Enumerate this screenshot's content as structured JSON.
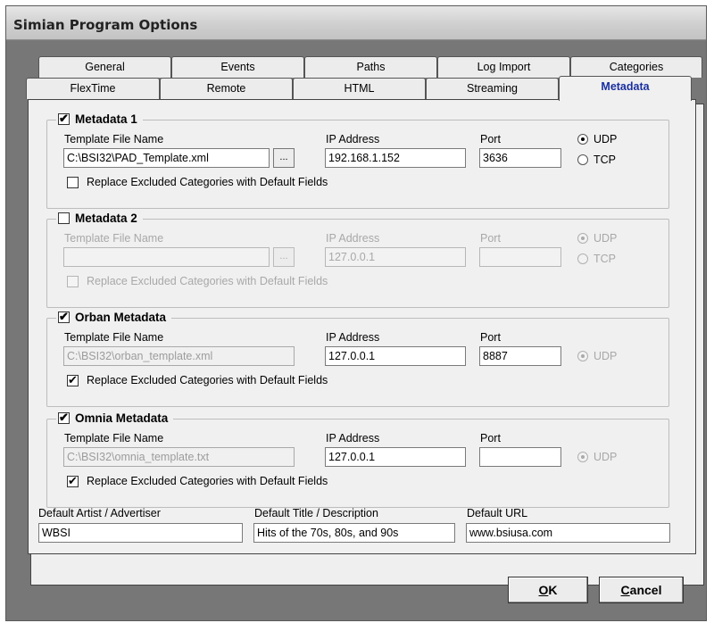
{
  "window": {
    "title": "Simian Program Options"
  },
  "tabs_row1": [
    "General",
    "Events",
    "Paths",
    "Log Import",
    "Categories"
  ],
  "tabs_row2": [
    "FlexTime",
    "Remote",
    "HTML",
    "Streaming",
    "Metadata"
  ],
  "labels": {
    "template": "Template File Name",
    "ip": "IP Address",
    "port": "Port",
    "udp": "UDP",
    "tcp": "TCP",
    "replace": "Replace Excluded Categories with Default Fields",
    "browse": "..."
  },
  "metadata1": {
    "title": "Metadata 1",
    "template": "C:\\BSI32\\PAD_Template.xml",
    "ip": "192.168.1.152",
    "port": "3636"
  },
  "metadata2": {
    "title": "Metadata 2",
    "template": "",
    "ip": "127.0.0.1",
    "port": ""
  },
  "orban": {
    "title": "Orban Metadata",
    "template": "C:\\BSI32\\orban_template.xml",
    "ip": "127.0.0.1",
    "port": "8887"
  },
  "omnia": {
    "title": "Omnia Metadata",
    "template": "C:\\BSI32\\omnia_template.txt",
    "ip": "127.0.0.1",
    "port": ""
  },
  "defaults": {
    "artist_label": "Default Artist / Advertiser",
    "artist": "WBSI",
    "title_label": "Default Title / Description",
    "title": "Hits of the 70s, 80s, and 90s",
    "url_label": "Default URL",
    "url": "www.bsiusa.com"
  },
  "buttons": {
    "ok_hot": "O",
    "ok_rest": "K",
    "cancel_hot": "C",
    "cancel_rest": "ancel"
  }
}
